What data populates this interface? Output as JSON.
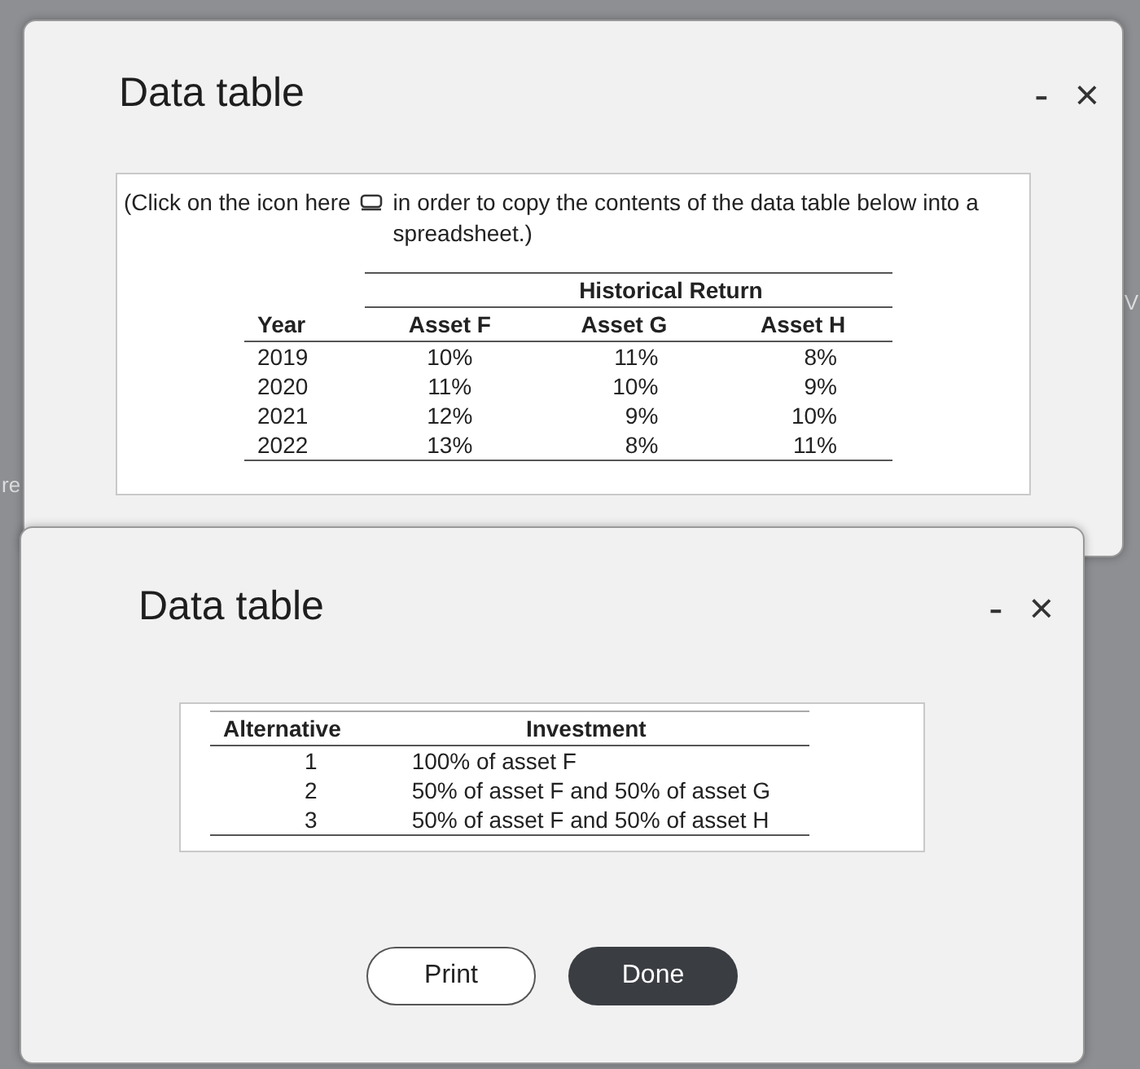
{
  "background_text": [
    "re",
    "V"
  ],
  "dialogs": [
    {
      "title": "Data table",
      "minimize": "-",
      "close": "×",
      "note": {
        "before": "(Click on the icon here",
        "after": "in order to copy the contents of the data table below into a spreadsheet.)"
      },
      "table": {
        "group_header": "Historical Return",
        "columns": [
          "Year",
          "Asset F",
          "Asset G",
          "Asset H"
        ],
        "rows": [
          [
            "2019",
            "10%",
            "11%",
            "8%"
          ],
          [
            "2020",
            "11%",
            "10%",
            "9%"
          ],
          [
            "2021",
            "12%",
            "9%",
            "10%"
          ],
          [
            "2022",
            "13%",
            "8%",
            "11%"
          ]
        ]
      }
    },
    {
      "title": "Data table",
      "minimize": "-",
      "close": "×",
      "table": {
        "columns": [
          "Alternative",
          "Investment"
        ],
        "rows": [
          [
            "1",
            "100% of asset F"
          ],
          [
            "2",
            "50% of asset F and 50% of asset G"
          ],
          [
            "3",
            "50% of asset F and 50% of asset H"
          ]
        ]
      },
      "buttons": [
        {
          "label": "Print",
          "kind": "secondary"
        },
        {
          "label": "Done",
          "kind": "primary"
        }
      ]
    }
  ]
}
